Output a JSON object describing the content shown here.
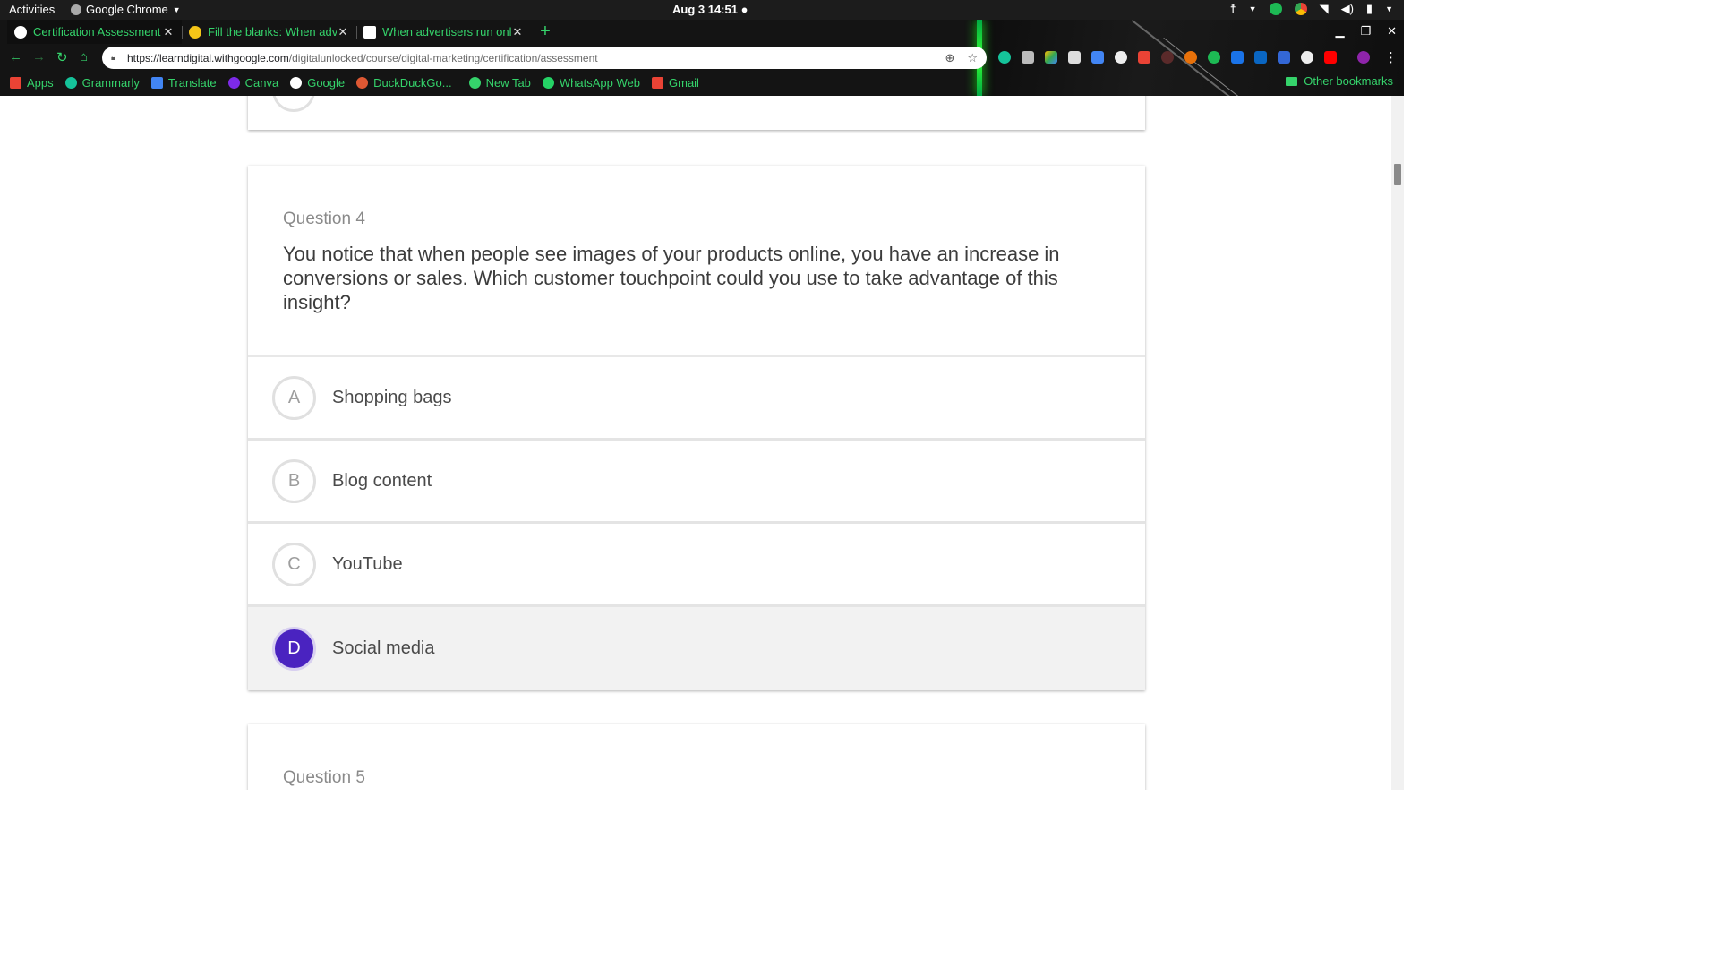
{
  "os_bar": {
    "activities": "Activities",
    "app_name": "Google Chrome",
    "clock": "Aug 3  14:51"
  },
  "browser": {
    "tabs": [
      {
        "title": "Certification Assessment",
        "favicon_color": "#ffffff"
      },
      {
        "title": "Fill the blanks: When adve",
        "favicon_color": "#f5c518"
      },
      {
        "title": "When advertisers run onl",
        "favicon_color": "#ffffff"
      }
    ],
    "url_host": "https://learndigital.withgoogle.com",
    "url_path": "/digitalunlocked/course/digital-marketing/certification/assessment",
    "bookmarks": [
      {
        "label": "Apps",
        "icon_color": "#ea4335"
      },
      {
        "label": "Grammarly",
        "icon_color": "#15c39a"
      },
      {
        "label": "Translate",
        "icon_color": "#4285f4"
      },
      {
        "label": "Canva",
        "icon_color": "#7d2ae8"
      },
      {
        "label": "Google",
        "icon_color": "#ffffff"
      },
      {
        "label": "DuckDuckGo...",
        "icon_color": "#de5833"
      },
      {
        "label": "New Tab",
        "icon_color": "#35d36b"
      },
      {
        "label": "WhatsApp Web",
        "icon_color": "#25d366"
      },
      {
        "label": "Gmail",
        "icon_color": "#ea4335"
      }
    ],
    "other_bookmarks": "Other bookmarks",
    "accent_color": "#35d36b"
  },
  "quiz": {
    "question_label": "Question 4",
    "question_text": "You notice that when people see images of your products online, you have an increase in conversions or sales. Which customer touchpoint could you use to take advantage of this insight?",
    "options": [
      {
        "letter": "A",
        "text": "Shopping bags",
        "selected": false
      },
      {
        "letter": "B",
        "text": "Blog content",
        "selected": false
      },
      {
        "letter": "C",
        "text": "YouTube",
        "selected": false
      },
      {
        "letter": "D",
        "text": "Social media",
        "selected": true
      }
    ],
    "selected_color": "#4a23c0",
    "next_question_label": "Question 5"
  }
}
